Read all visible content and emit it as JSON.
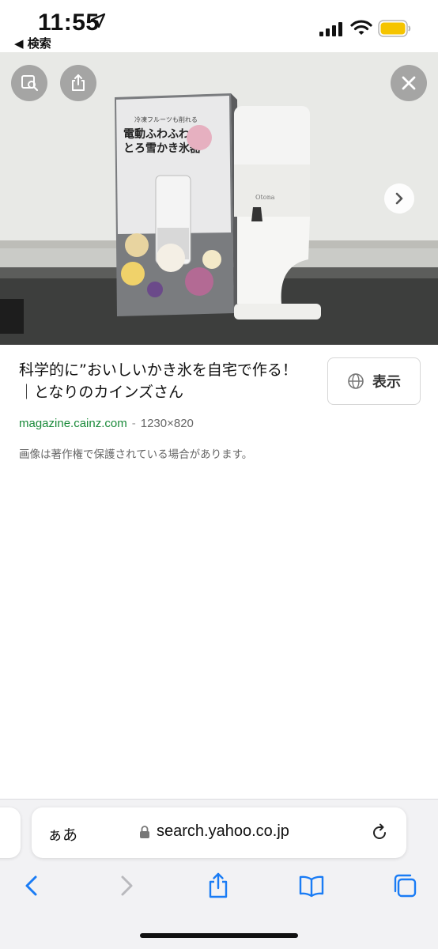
{
  "status_bar": {
    "time": "11:55",
    "back_label": "◀ 検索",
    "battery_color": "#f5c400"
  },
  "image_viewer": {
    "buttons": [
      "lens-icon",
      "share-icon",
      "close-icon",
      "chevron-right-icon"
    ],
    "product_box_text": {
      "small": "冷凍フルーツも削れる",
      "line1": "電動ふわふわ",
      "line2": "とろ雪かき氷器"
    },
    "device_brand": "Otona"
  },
  "result": {
    "title": "科学的に”おいしいかき氷を自宅で作る！｜となりのカインズさん",
    "view_button_label": "表示",
    "domain": "magazine.cainz.com",
    "separator": "-",
    "dimensions": "1230×820",
    "copyright_notice": "画像は著作権で保護されている場合があります。"
  },
  "browser": {
    "text_size_label": "ぁあ",
    "url": "search.yahoo.co.jp",
    "accent_color": "#1a7cf5"
  }
}
